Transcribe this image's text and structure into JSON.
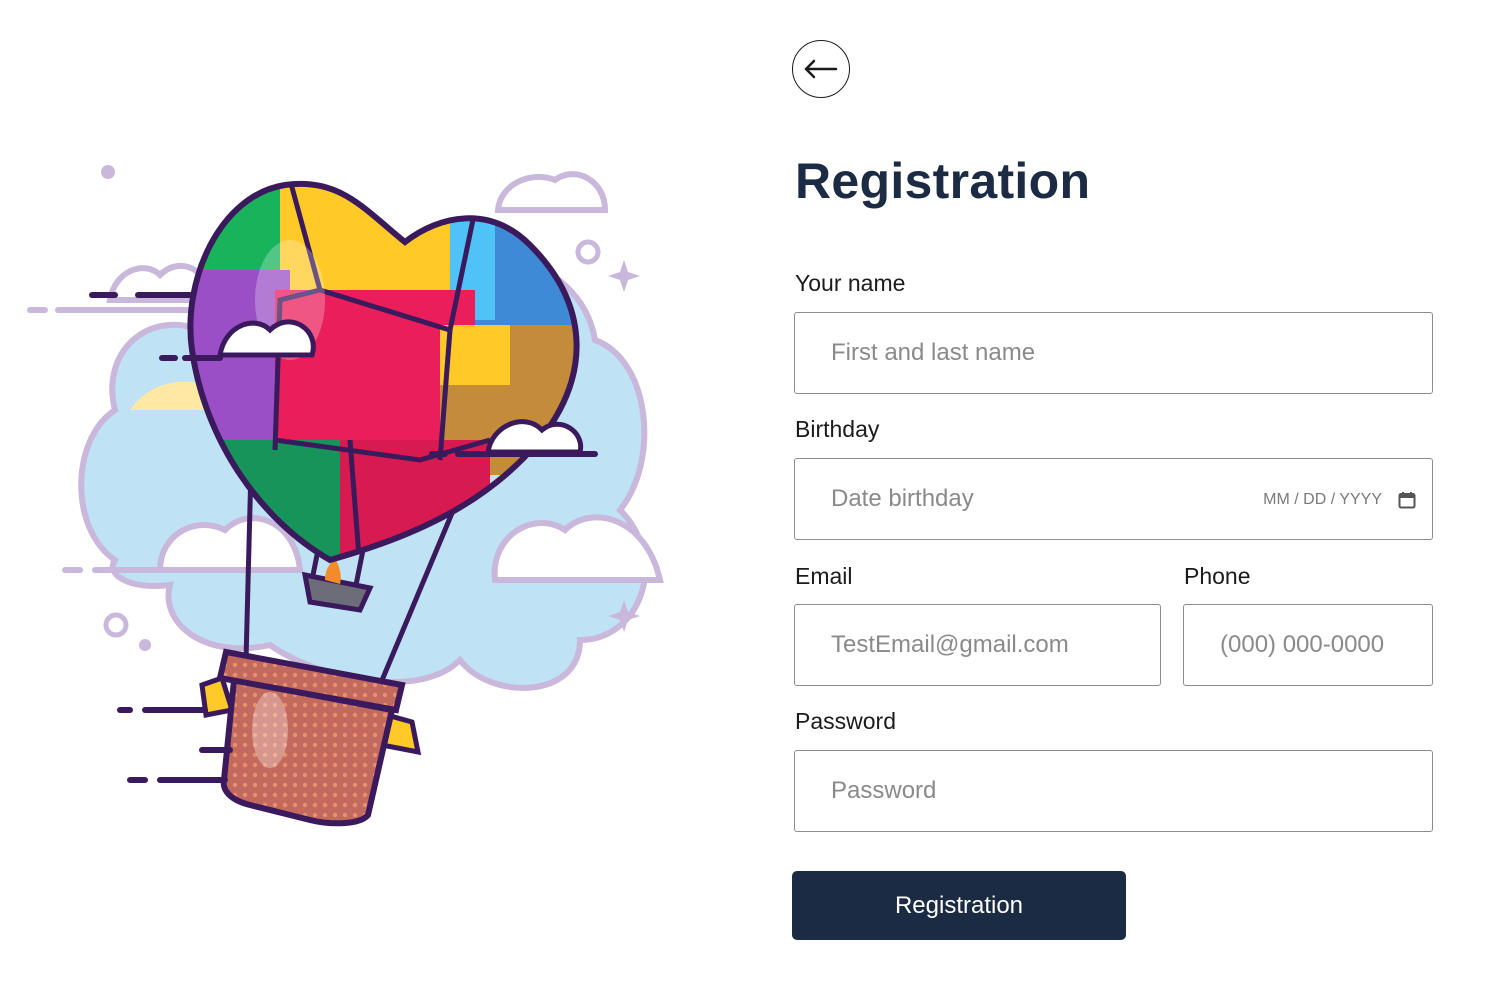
{
  "form": {
    "title": "Registration",
    "name": {
      "label": "Your name",
      "placeholder": "First and last name"
    },
    "birthday": {
      "label": "Birthday",
      "placeholder": "Date birthday",
      "format_hint": "MM / DD / YYYY"
    },
    "email": {
      "label": "Email",
      "placeholder": "TestEmail@gmail.com"
    },
    "phone": {
      "label": "Phone",
      "placeholder": "(000) 000-0000"
    },
    "password": {
      "label": "Password",
      "placeholder": "Password"
    },
    "submit_label": "Registration"
  },
  "icons": {
    "back": "arrow-left-icon",
    "calendar": "calendar-icon",
    "illustration": "hot-air-balloon-puzzle-heart"
  },
  "colors": {
    "primary": "#1b2b43",
    "input_border": "#8c8c8c",
    "placeholder": "#8a8a8a"
  }
}
